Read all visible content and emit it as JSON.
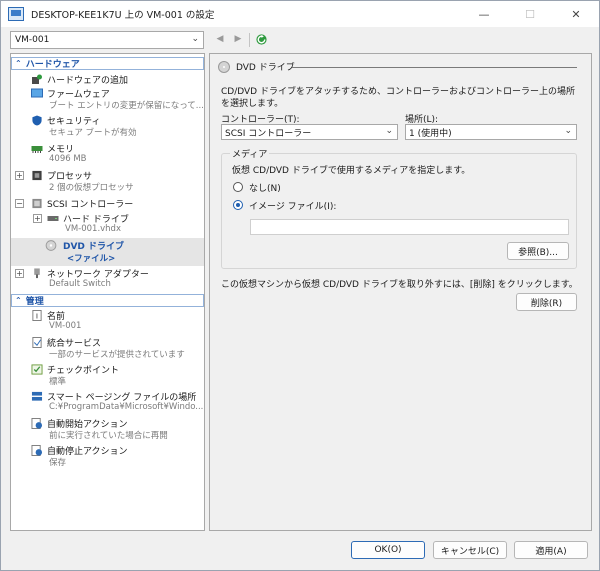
{
  "window": {
    "title": "DESKTOP-KEE1K7U 上の VM-001 の設定"
  },
  "toolbar": {
    "vm_name": "VM-001"
  },
  "sidebar": {
    "hardware_header": "ハードウェア",
    "add_hardware": "ハードウェアの追加",
    "firmware": {
      "label": "ファームウェア",
      "sub": "ブート エントリの変更が保留になって..."
    },
    "security": {
      "label": "セキュリティ",
      "sub": "セキュア ブートが有効"
    },
    "memory": {
      "label": "メモリ",
      "sub": "4096 MB"
    },
    "processor": {
      "label": "プロセッサ",
      "sub": "2 個の仮想プロセッサ"
    },
    "scsi": {
      "label": "SCSI コントローラー"
    },
    "hard_drive": {
      "label": "ハード ドライブ",
      "sub": "VM-001.vhdx"
    },
    "dvd_drive": {
      "label": "DVD ドライブ",
      "sub": "<ファイル>"
    },
    "network": {
      "label": "ネットワーク アダプター",
      "sub": "Default Switch"
    },
    "management_header": "管理",
    "name": {
      "label": "名前",
      "sub": "VM-001"
    },
    "integration": {
      "label": "統合サービス",
      "sub": "一部のサービスが提供されています"
    },
    "checkpoint": {
      "label": "チェックポイント",
      "sub": "標準"
    },
    "smart_paging": {
      "label": "スマート ページング ファイルの場所",
      "sub": "C:¥ProgramData¥Microsoft¥Windo..."
    },
    "auto_start": {
      "label": "自動開始アクション",
      "sub": "前に実行されていた場合に再開"
    },
    "auto_stop": {
      "label": "自動停止アクション",
      "sub": "保存"
    }
  },
  "main": {
    "section_title": "DVD ドライブ",
    "description": "CD/DVD ドライブをアタッチするため、コントローラーおよびコントローラー上の場所を選択します。",
    "controller_label": "コントローラー(T):",
    "controller_value": "SCSI コントローラー",
    "location_label": "場所(L):",
    "location_value": "1 (使用中)",
    "media_title": "メディア",
    "media_desc": "仮想 CD/DVD ドライブで使用するメディアを指定します。",
    "none_label": "なし(N)",
    "image_file_label": "イメージ ファイル(I):",
    "image_file_value": "",
    "browse_label": "参照(B)...",
    "remove_desc": "この仮想マシンから仮想 CD/DVD ドライブを取り外すには、[削除] をクリックします。",
    "remove_label": "削除(R)",
    "media_selected": "image_file"
  },
  "footer": {
    "ok": "OK(O)",
    "cancel": "キャンセル(C)",
    "apply": "適用(A)"
  }
}
